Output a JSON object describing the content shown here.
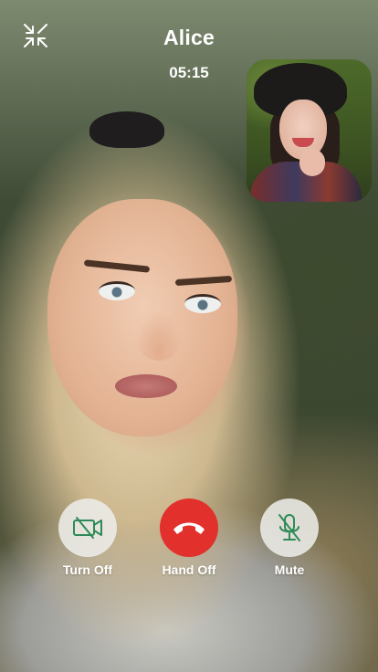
{
  "call": {
    "caller_name": "Alice",
    "duration": "05:15"
  },
  "top_bar": {
    "minimize_icon": "minimize-arrows-icon"
  },
  "self_view": {
    "description_icon": "self-camera-preview"
  },
  "controls": {
    "video": {
      "label": "Turn Off",
      "icon": "video-off-icon",
      "icon_color": "#2e8b57"
    },
    "hangup": {
      "label": "Hand Off",
      "icon": "phone-hangup-icon",
      "bg_color": "#e2312c"
    },
    "mute": {
      "label": "Mute",
      "icon": "mic-off-icon",
      "icon_color": "#2e8b57"
    }
  },
  "colors": {
    "accent_green": "#2e8b57",
    "hangup_red": "#e2312c",
    "text": "#ffffff"
  }
}
